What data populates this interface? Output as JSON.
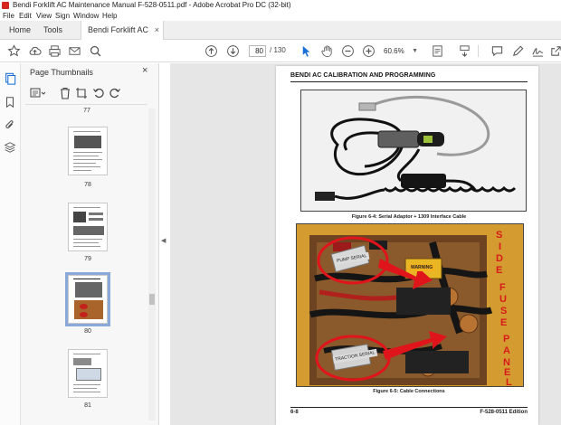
{
  "window": {
    "title": "Bendi Forklift AC Maintenance Manual F-528-0511.pdf - Adobe Acrobat Pro DC (32-bit)"
  },
  "menu": [
    "File",
    "Edit",
    "View",
    "Sign",
    "Window",
    "Help"
  ],
  "tabs": {
    "home": "Home",
    "tools": "Tools",
    "document": "Bendi Forklift AC M...",
    "close_glyph": "×"
  },
  "toolbar": {
    "current_page": "80",
    "total_pages": "/ 130",
    "zoom": "60.6%",
    "icons": [
      "bookmark-star-icon",
      "cloud-upload-icon",
      "print-icon",
      "email-icon",
      "search-icon",
      "page-up-icon",
      "page-down-icon",
      "select-cursor-icon",
      "hand-tool-icon",
      "zoom-out-icon",
      "zoom-in-icon",
      "fit-page-icon",
      "scroll-mode-icon",
      "comment-icon",
      "pen-icon",
      "sign-icon",
      "share-icon"
    ]
  },
  "thumbnails_panel": {
    "title": "Page Thumbnails",
    "close_glyph": "×",
    "pages": [
      {
        "label": "77"
      },
      {
        "label": "78"
      },
      {
        "label": "79"
      },
      {
        "label": "80",
        "selected": true
      },
      {
        "label": "81"
      }
    ]
  },
  "document": {
    "header": "BENDI AC CALIBRATION AND PROGRAMMING",
    "figure1_caption": "Figure 6-4:  Serial Adaptor + 1309 Interface Cable",
    "figure2_caption": "Figure 6-5:  Cable Connections",
    "side_label": [
      "S",
      "I",
      "D",
      "E",
      "F",
      "U",
      "S",
      "E",
      "P",
      "A",
      "N",
      "E",
      "L"
    ],
    "photo_label_1": "PUMP SERIAL",
    "photo_label_2": "TRACTION SERIAL",
    "warning_text": "WARNING",
    "footer_left": "6-8",
    "footer_right": "F-528-0511 Edition"
  },
  "colors": {
    "accent_red": "#d71a1a",
    "acrobat_red": "#d7261e",
    "selection_blue": "#8aa9d8"
  }
}
